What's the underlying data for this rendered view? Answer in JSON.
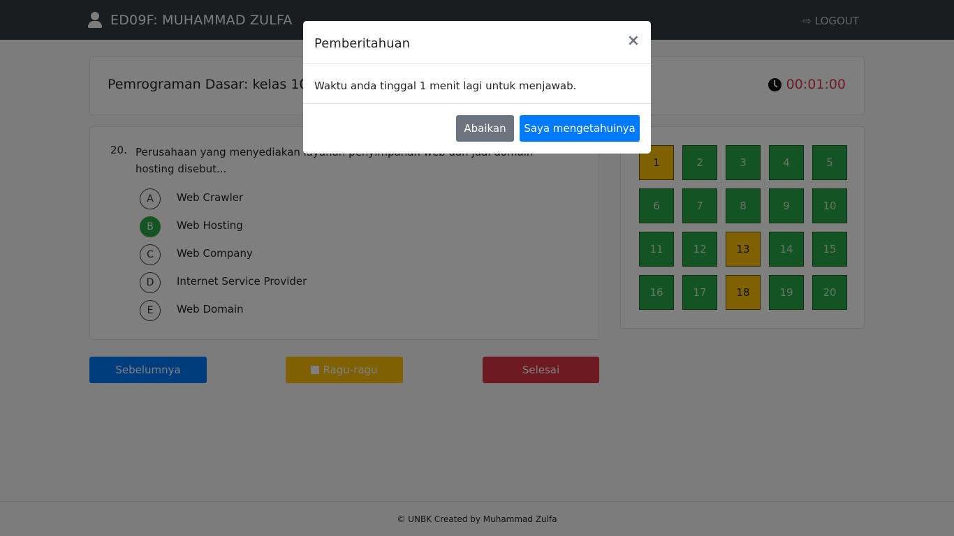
{
  "navbar": {
    "user_name": "ED09F: MUHAMMAD ZULFA",
    "logout_label": "LOGOUT"
  },
  "exam": {
    "subject": "Pemrograman Dasar: kelas 10 TKJ",
    "time_left": "00:01:00"
  },
  "question": {
    "number": "20.",
    "text": "Perusahaan yang menyediakan layanan penyimpanan web dan jual domain hosting disebut...",
    "options": [
      {
        "letter": "A",
        "text": "Web Crawler",
        "selected": false
      },
      {
        "letter": "B",
        "text": "Web Hosting",
        "selected": true
      },
      {
        "letter": "C",
        "text": "Web Company",
        "selected": false
      },
      {
        "letter": "D",
        "text": "Internet Service Provider",
        "selected": false
      },
      {
        "letter": "E",
        "text": "Web Domain",
        "selected": false
      }
    ]
  },
  "navigation": {
    "numbers": [
      {
        "label": "1",
        "status": "doubt"
      },
      {
        "label": "2",
        "status": "answered"
      },
      {
        "label": "3",
        "status": "answered"
      },
      {
        "label": "4",
        "status": "answered"
      },
      {
        "label": "5",
        "status": "answered"
      },
      {
        "label": "6",
        "status": "answered"
      },
      {
        "label": "7",
        "status": "answered"
      },
      {
        "label": "8",
        "status": "answered"
      },
      {
        "label": "9",
        "status": "answered"
      },
      {
        "label": "10",
        "status": "answered"
      },
      {
        "label": "11",
        "status": "answered"
      },
      {
        "label": "12",
        "status": "answered"
      },
      {
        "label": "13",
        "status": "doubt"
      },
      {
        "label": "14",
        "status": "answered"
      },
      {
        "label": "15",
        "status": "answered"
      },
      {
        "label": "16",
        "status": "answered"
      },
      {
        "label": "17",
        "status": "answered"
      },
      {
        "label": "18",
        "status": "doubt"
      },
      {
        "label": "19",
        "status": "answered"
      },
      {
        "label": "20",
        "status": "answered"
      }
    ]
  },
  "buttons": {
    "prev_label": "Sebelumnya",
    "doubt_label": "Ragu-ragu",
    "finish_label": "Selesai"
  },
  "footer": {
    "text": "© UNBK Created by Muhammad Zulfa"
  },
  "modal": {
    "title": "Pemberitahuan",
    "close_label": "×",
    "message": "Waktu anda tinggal 1 menit lagi untuk menjawab.",
    "ignore_label": "Abaikan",
    "ok_label": "Saya mengetahuinya"
  },
  "colors": {
    "answered": "#28a745",
    "doubt": "#ffc107",
    "primary": "#007bff",
    "danger": "#dc3545",
    "secondary": "#6c757d",
    "navbar": "#343a40"
  }
}
